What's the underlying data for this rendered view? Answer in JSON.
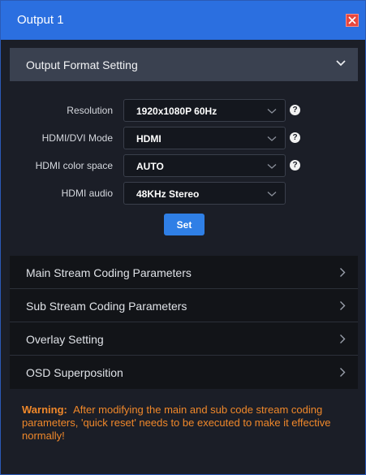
{
  "window": {
    "title": "Output 1"
  },
  "format_section": {
    "title": "Output Format Setting",
    "rows": [
      {
        "label": "Resolution",
        "value": "1920x1080P 60Hz",
        "help": "?"
      },
      {
        "label": "HDMI/DVI Mode",
        "value": "HDMI",
        "help": "?"
      },
      {
        "label": "HDMI color space",
        "value": "AUTO",
        "help": "?"
      },
      {
        "label": "HDMI audio",
        "value": "48KHz Stereo"
      }
    ],
    "set_label": "Set"
  },
  "sections": [
    {
      "label": "Main Stream Coding Parameters"
    },
    {
      "label": "Sub Stream Coding Parameters"
    },
    {
      "label": "Overlay Setting"
    },
    {
      "label": "OSD Superposition"
    }
  ],
  "warning": {
    "title": "Warning:",
    "text": "After modifying the main and sub code stream coding parameters, 'quick reset' needs to be executed to make it effective normally!"
  },
  "colors": {
    "titlebar": "#2b6fe0",
    "close": "#e8473d",
    "accent_button": "#2f7fe6",
    "warning": "#f0882a"
  },
  "icons": {
    "close": "close-icon",
    "expand": "chevron-down-icon",
    "collapsed": "chevron-right-icon",
    "help": "question-circle-icon",
    "dropdown": "dropdown-arrow-icon"
  }
}
